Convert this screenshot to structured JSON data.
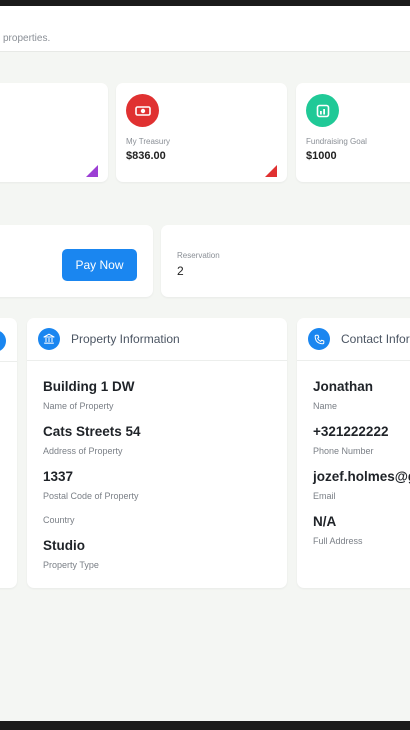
{
  "header": {
    "subtitle": "properties."
  },
  "stats": [
    {
      "label": "My Treasury",
      "value": "$836.00",
      "icon": "money-icon",
      "color": "#e03131"
    },
    {
      "label": "Fundraising Goal",
      "value": "$1000",
      "icon": "chart-icon",
      "color": "#20c997"
    }
  ],
  "corner_colors": {
    "purple": "#9c3fd4",
    "red": "#e03131"
  },
  "payment": {
    "button_label": "Pay Now"
  },
  "reservation": {
    "label": "Reservation",
    "value": "2"
  },
  "property_info": {
    "title": "Property Information",
    "icon": "bank-icon",
    "fields": [
      {
        "value": "Building 1 DW",
        "label": "Name of Property"
      },
      {
        "value": "Cats Streets 54",
        "label": "Address of Property"
      },
      {
        "value": "1337",
        "label": "Postal Code of Property"
      },
      {
        "value": "",
        "label": "Country"
      },
      {
        "value": "Studio",
        "label": "Property Type"
      }
    ]
  },
  "contact_info": {
    "title": "Contact Infor",
    "icon": "phone-icon",
    "fields": [
      {
        "value": "Jonathan",
        "label": "Name"
      },
      {
        "value": "+321222222",
        "label": "Phone Number"
      },
      {
        "value": "jozef.holmes@g",
        "label": "Email"
      },
      {
        "value": "N/A",
        "label": "Full Address"
      }
    ]
  },
  "accent_color": "#1a86f0"
}
